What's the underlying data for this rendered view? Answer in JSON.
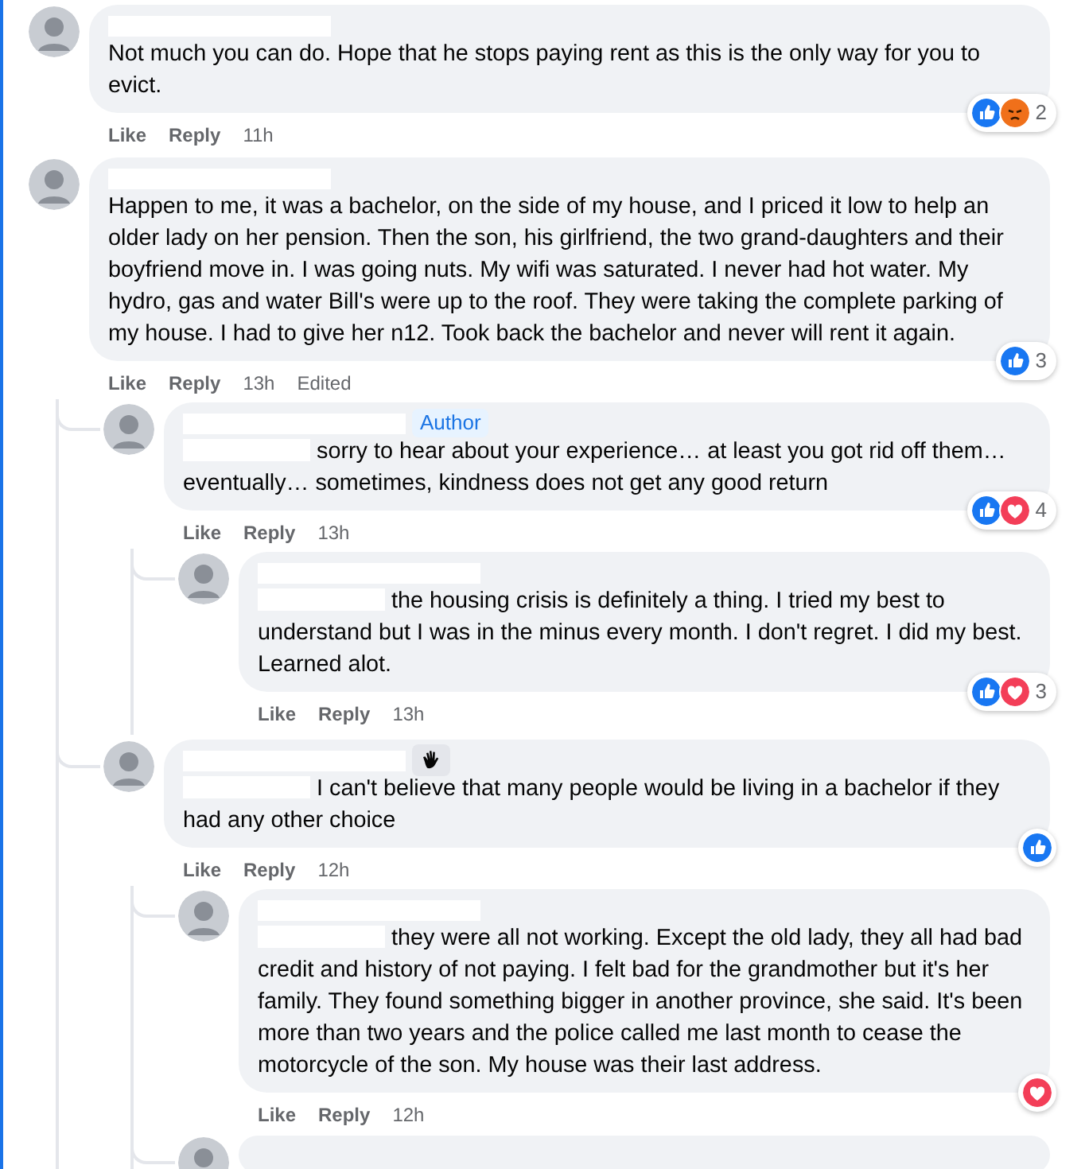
{
  "comments": [
    {
      "mention_redacted": false,
      "text": "Not much you can do. Hope that he stops paying rent as this is the only way for you to evict.",
      "actions": [
        "Like",
        "Reply"
      ],
      "time": "11h",
      "reactions": {
        "icons": [
          {
            "kind": "like"
          },
          {
            "kind": "angry"
          }
        ],
        "count": "2"
      }
    },
    {
      "mention_redacted": false,
      "text": "Happen to me, it was a bachelor, on the side of my house, and I priced it low to help an older lady on her pension. Then the son, his girlfriend, the two grand-daughters and their boyfriend move in. I was going nuts. My wifi was saturated. I never had hot water. My hydro, gas and water Bill's were up to the roof. They were taking the complete parking of my house. I had to give her n12. Took back the bachelor and never will rent it again.",
      "actions": [
        "Like",
        "Reply"
      ],
      "time": "13h",
      "edited": "Edited",
      "reactions": {
        "icons": [
          {
            "kind": "like"
          }
        ],
        "count": "3"
      },
      "replies": [
        {
          "badge": {
            "kind": "label",
            "label": "Author"
          },
          "mention_redacted": true,
          "text": "sorry to hear about your experience… at least you got rid off them… eventually… sometimes, kindness does not get any good return",
          "actions": [
            "Like",
            "Reply"
          ],
          "time": "13h",
          "reactions": {
            "icons": [
              {
                "kind": "like"
              },
              {
                "kind": "love"
              }
            ],
            "count": "4"
          },
          "replies": [
            {
              "mention_redacted": true,
              "text": "the housing crisis is definitely a thing. I tried my best to understand but I was in the minus every month. I don't regret. I did my best. Learned alot.",
              "actions": [
                "Like",
                "Reply"
              ],
              "time": "13h",
              "reactions": {
                "icons": [
                  {
                    "kind": "like"
                  },
                  {
                    "kind": "love"
                  }
                ],
                "count": "3"
              }
            }
          ]
        },
        {
          "badge": {
            "kind": "wave"
          },
          "mention_redacted": true,
          "text": "I can't believe that many people would be living in a bachelor if they had any other choice",
          "actions": [
            "Like",
            "Reply"
          ],
          "time": "12h",
          "reactions": {
            "icons": [
              {
                "kind": "like"
              }
            ]
          },
          "replies": [
            {
              "mention_redacted": true,
              "text": "they were all not working. Except the old lady, they all had bad credit and history of not paying. I felt bad for the grandmother but it's her family. They found something bigger in another province, she said. It's been more than two years and the police called me last month to cease the motorcycle of the son. My house was their last address.",
              "actions": [
                "Like",
                "Reply"
              ],
              "time": "12h",
              "reactions": {
                "icons": [
                  {
                    "kind": "love"
                  }
                ]
              }
            },
            {
              "partial": true
            }
          ]
        }
      ]
    }
  ]
}
